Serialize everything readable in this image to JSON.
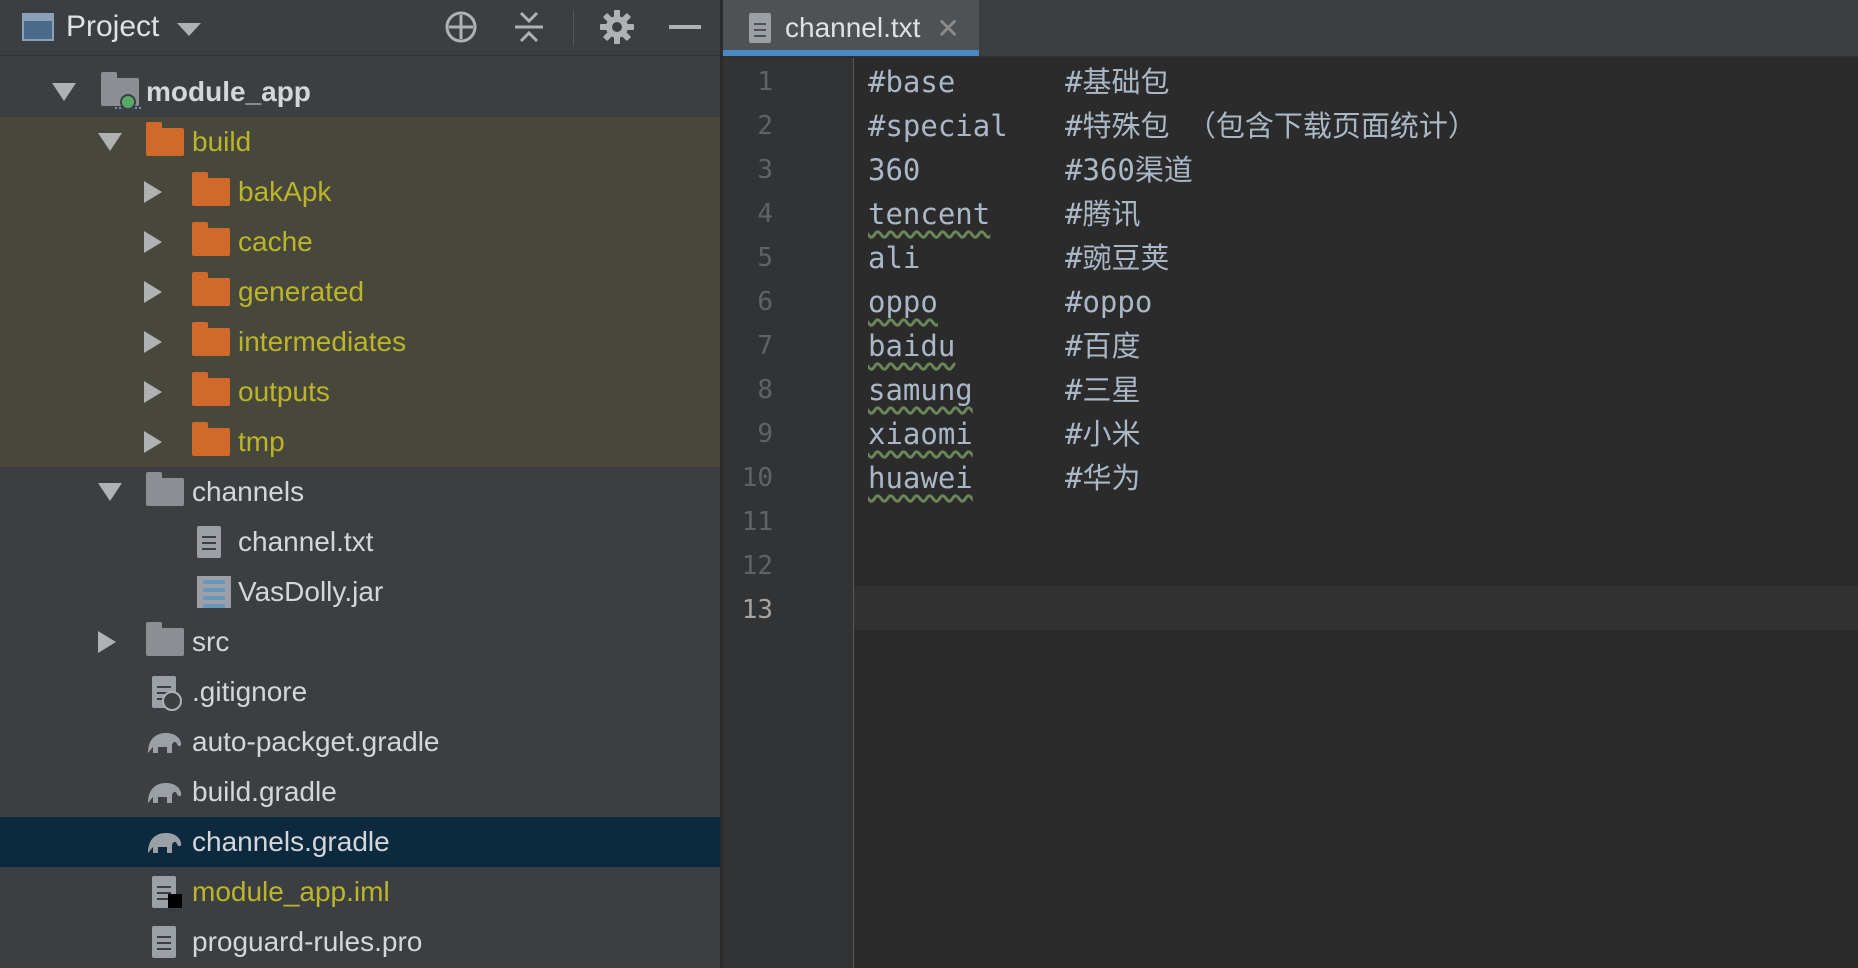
{
  "project_panel": {
    "title": "Project",
    "tree": [
      {
        "label": "module_app",
        "kind": "module",
        "depth": 0,
        "expanded": true,
        "style": "bold"
      },
      {
        "label": "build",
        "kind": "folder-excluded",
        "depth": 1,
        "expanded": true,
        "style": "olive"
      },
      {
        "label": "bakApk",
        "kind": "folder-excluded",
        "depth": 2,
        "expanded": false,
        "style": "olive"
      },
      {
        "label": "cache",
        "kind": "folder-excluded",
        "depth": 2,
        "expanded": false,
        "style": "olive"
      },
      {
        "label": "generated",
        "kind": "folder-excluded",
        "depth": 2,
        "expanded": false,
        "style": "olive"
      },
      {
        "label": "intermediates",
        "kind": "folder-excluded",
        "depth": 2,
        "expanded": false,
        "style": "olive"
      },
      {
        "label": "outputs",
        "kind": "folder-excluded",
        "depth": 2,
        "expanded": false,
        "style": "olive"
      },
      {
        "label": "tmp",
        "kind": "folder-excluded",
        "depth": 2,
        "expanded": false,
        "style": "olive"
      },
      {
        "label": "channels",
        "kind": "folder",
        "depth": 1,
        "expanded": true
      },
      {
        "label": "channel.txt",
        "kind": "text-file",
        "depth": 2
      },
      {
        "label": "VasDolly.jar",
        "kind": "jar-file",
        "depth": 2
      },
      {
        "label": "src",
        "kind": "folder",
        "depth": 1,
        "expanded": false
      },
      {
        "label": ".gitignore",
        "kind": "ignore-file",
        "depth": 1
      },
      {
        "label": "auto-packget.gradle",
        "kind": "gradle-file",
        "depth": 1
      },
      {
        "label": "build.gradle",
        "kind": "gradle-file",
        "depth": 1
      },
      {
        "label": "channels.gradle",
        "kind": "gradle-file",
        "depth": 1,
        "selected": true
      },
      {
        "label": "module_app.iml",
        "kind": "iml-file",
        "depth": 1,
        "style": "olive"
      },
      {
        "label": "proguard-rules.pro",
        "kind": "text-file",
        "depth": 1
      }
    ]
  },
  "editor": {
    "tab": {
      "label": "channel.txt",
      "close": "✕"
    },
    "current_line": 13,
    "lines": [
      {
        "num": "1",
        "key": "#base",
        "comment": "#基础包",
        "typo": false
      },
      {
        "num": "2",
        "key": "#special",
        "comment": "#特殊包 （包含下载页面统计）",
        "typo": false
      },
      {
        "num": "3",
        "key": "360",
        "comment": "#360渠道",
        "typo": false
      },
      {
        "num": "4",
        "key": "tencent",
        "comment": "#腾讯",
        "typo": true
      },
      {
        "num": "5",
        "key": "ali",
        "comment": "#豌豆荚",
        "typo": false
      },
      {
        "num": "6",
        "key": "oppo",
        "comment": "#oppo",
        "typo": true
      },
      {
        "num": "7",
        "key": "baidu",
        "comment": "#百度",
        "typo": true
      },
      {
        "num": "8",
        "key": "samung",
        "comment": "#三星",
        "typo": true
      },
      {
        "num": "9",
        "key": "xiaomi",
        "comment": "#小米",
        "typo": true
      },
      {
        "num": "10",
        "key": "huawei",
        "comment": "#华为",
        "typo": true
      },
      {
        "num": "11",
        "key": "",
        "comment": "",
        "typo": false
      },
      {
        "num": "12",
        "key": "",
        "comment": "",
        "typo": false
      },
      {
        "num": "13",
        "key": "",
        "comment": "",
        "typo": false
      }
    ]
  },
  "colors": {
    "panel_bg": "#3c3f41",
    "editor_bg": "#2b2b2b",
    "excluded_highlight": "#48473b",
    "selection": "#0d293e",
    "excluded_text": "#bbb529",
    "folder_orange": "#d0692a",
    "tab_accent": "#4a88c7"
  }
}
